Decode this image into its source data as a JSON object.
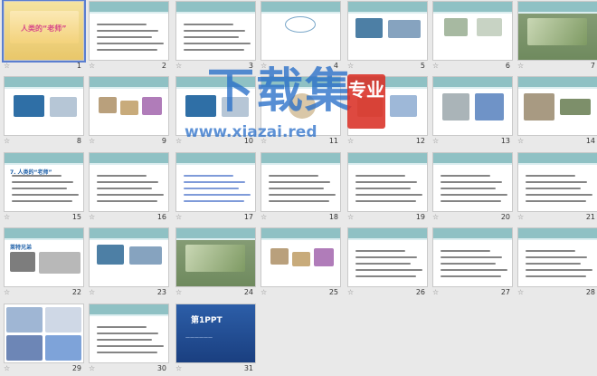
{
  "slides": [
    {
      "n": "1",
      "title": "人类的“老师”",
      "kind": "cover"
    },
    {
      "n": "2",
      "title": "",
      "kind": "text"
    },
    {
      "n": "3",
      "title": "",
      "kind": "text"
    },
    {
      "n": "4",
      "title": "",
      "kind": "bubble"
    },
    {
      "n": "5",
      "title": "",
      "kind": "fish"
    },
    {
      "n": "6",
      "title": "",
      "kind": "heli"
    },
    {
      "n": "7",
      "title": "",
      "kind": "dragonfly"
    },
    {
      "n": "8",
      "title": "",
      "kind": "dolphin"
    },
    {
      "n": "9",
      "title": "",
      "kind": "insects"
    },
    {
      "n": "10",
      "title": "",
      "kind": "dolphin2"
    },
    {
      "n": "11",
      "title": "",
      "kind": "shell"
    },
    {
      "n": "12",
      "title": "",
      "kind": "photo"
    },
    {
      "n": "13",
      "title": "",
      "kind": "photo2"
    },
    {
      "n": "14",
      "title": "",
      "kind": "tank"
    },
    {
      "n": "15",
      "title": "7. 人类的“老师”",
      "kind": "list"
    },
    {
      "n": "16",
      "title": "",
      "kind": "text"
    },
    {
      "n": "17",
      "title": "",
      "kind": "textblue"
    },
    {
      "n": "18",
      "title": "",
      "kind": "table"
    },
    {
      "n": "19",
      "title": "",
      "kind": "text"
    },
    {
      "n": "20",
      "title": "",
      "kind": "text"
    },
    {
      "n": "21",
      "title": "",
      "kind": "text"
    },
    {
      "n": "22",
      "title": "莱特兄弟",
      "kind": "wright"
    },
    {
      "n": "23",
      "title": "",
      "kind": "fish2"
    },
    {
      "n": "24",
      "title": "",
      "kind": "dragon2"
    },
    {
      "n": "25",
      "title": "",
      "kind": "insects"
    },
    {
      "n": "26",
      "title": "",
      "kind": "text"
    },
    {
      "n": "27",
      "title": "",
      "kind": "text"
    },
    {
      "n": "28",
      "title": "",
      "kind": "text"
    },
    {
      "n": "29",
      "title": "",
      "kind": "city"
    },
    {
      "n": "30",
      "title": "",
      "kind": "text"
    },
    {
      "n": "31",
      "title": "第1PPT",
      "kind": "ppt"
    }
  ],
  "watermark": {
    "main": "下载集",
    "badge": "专业",
    "url": "www.xiazai.red"
  },
  "colors": {
    "accent": "#5b7fd0",
    "band": "#8fc1c4",
    "watermark": "#286ec8",
    "badge": "#da3026"
  }
}
